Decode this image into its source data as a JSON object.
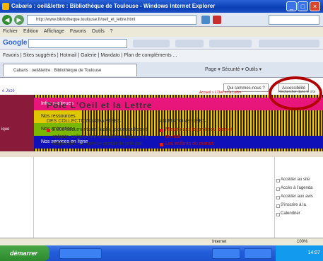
{
  "window": {
    "title": "Cabaris : oeil&lettre : Bibliothèque de Toulouse - Windows Internet Explorer"
  },
  "address": {
    "url": "http://www.bibliotheque.toulouse.fr/oeil_et_lettre.html"
  },
  "menubar": {
    "items": "Fichier Edition Affichage Favoris Outils ?"
  },
  "google": {
    "label": "Google"
  },
  "favorites": {
    "text": "Favoris | Sites suggérés | Hotmail | Galerie | Mandato | Plan de compléments ..."
  },
  "tab": {
    "label": "Cabaris : oeil&lettre : Bibliothèque de Toulouse",
    "tools": "Page ▾  Sécurité ▾  Outils ▾"
  },
  "toplinks": {
    "quisommes": "Qui sommes-nous ?",
    "accessibilite": "Accessibilité"
  },
  "banner": {
    "left_text": "ique"
  },
  "menu": {
    "item1": "Infos pratiques",
    "item2": "Nos ressources",
    "item3": "Nos animations",
    "item4": "Nos services en ligne"
  },
  "left": {
    "title": "e Jozé"
  },
  "breadcrumb": "Accueil > L'Oeil et la Lettre",
  "page_title": "Pôle L'Oeil et la Lettre",
  "col1": {
    "heading": "DES COLLECTIONS ADAPTÉES",
    "line1": "2 200 documents en braille, pour adultes et",
    "line2": "enfants, prêtent être consultés sur place ou",
    "line3": "empruntés. Un service gratuit de prêt par"
  },
  "col2": {
    "heading": "ANIMATIONS LIÉES",
    "link1": "Minuit dans le jardin du bien et",
    "link1b": "du mal",
    "link2": "Les enfants du marais"
  },
  "right": {
    "head": "Rechercher dans le site",
    "links": [
      "Accéder au site",
      "Accès à l'agenda",
      "Accéder aux avis",
      "S'inscrire à la",
      "Calendrier"
    ]
  },
  "status": {
    "text": "Internet",
    "zoom": "100%"
  },
  "taskbar": {
    "start": "démarrer",
    "clock": "14:07"
  }
}
